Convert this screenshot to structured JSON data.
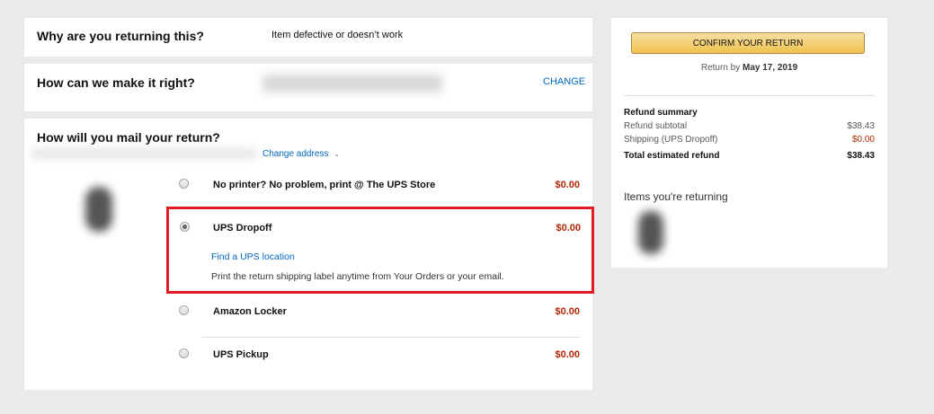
{
  "reason": {
    "title": "Why are you returning this?",
    "value": "Item defective or doesn’t work"
  },
  "resolution": {
    "title": "How can we make it right?",
    "change_label": "CHANGE"
  },
  "mail": {
    "title": "How will you mail your return?",
    "change_address": "Change address",
    "options": [
      {
        "label": "No printer? No problem, print @ The UPS Store",
        "price": "$0.00",
        "selected": false
      },
      {
        "label": "UPS Dropoff",
        "price": "$0.00",
        "selected": true,
        "link": "Find a UPS location",
        "note": "Print the return shipping label anytime from Your Orders or your email."
      },
      {
        "label": "Amazon Locker",
        "price": "$0.00",
        "selected": false
      },
      {
        "label": "UPS Pickup",
        "price": "$0.00",
        "selected": false
      }
    ]
  },
  "sidebar": {
    "confirm_label": "CONFIRM YOUR RETURN",
    "return_by_prefix": "Return by",
    "return_by_date": "May 17, 2019",
    "summary_title": "Refund summary",
    "rows": [
      {
        "label": "Refund subtotal",
        "value": "$38.43"
      },
      {
        "label": "Shipping (UPS Dropoff)",
        "value": "$0.00"
      }
    ],
    "total_label": "Total estimated refund",
    "total_value": "$38.43",
    "items_title": "Items you're returning"
  },
  "colors": {
    "accent_highlight": "#e31b23",
    "price": "#b12704",
    "link": "#0066c0"
  }
}
